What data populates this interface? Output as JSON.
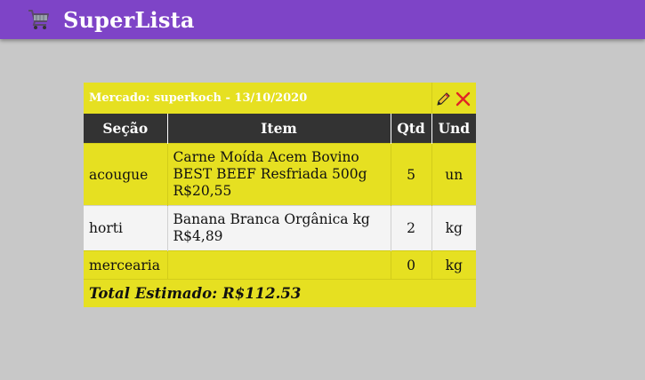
{
  "app": {
    "title": "SuperLista",
    "icon": "shopping-cart-icon"
  },
  "list": {
    "market_label": "Mercado: superkoch - 13/10/2020",
    "edit_icon": "pencil-icon",
    "delete_icon": "close-icon",
    "columns": [
      "Seção",
      "Item",
      "Qtd",
      "Und"
    ],
    "rows": [
      {
        "secao": "acougue",
        "item_line1": "Carne Moída Acem Bovino",
        "item_line2": "BEST BEEF Resfriada 500g",
        "item_price": "R$20,55",
        "qtd": "5",
        "und": "un"
      },
      {
        "secao": "horti",
        "item_line1": "Banana Branca Orgânica kg",
        "item_line2": "",
        "item_price": "R$4,89",
        "qtd": "2",
        "und": "kg"
      },
      {
        "secao": "mercearia",
        "item_line1": "",
        "item_line2": "",
        "item_price": "",
        "qtd": "0",
        "und": "kg"
      }
    ],
    "total": "Total Estimado: R$112.53"
  },
  "colors": {
    "header_bar": "#7e44c7",
    "row_yellow": "#e6e021",
    "column_header": "#333333",
    "background": "#c8c8c8",
    "delete": "#e02424"
  }
}
